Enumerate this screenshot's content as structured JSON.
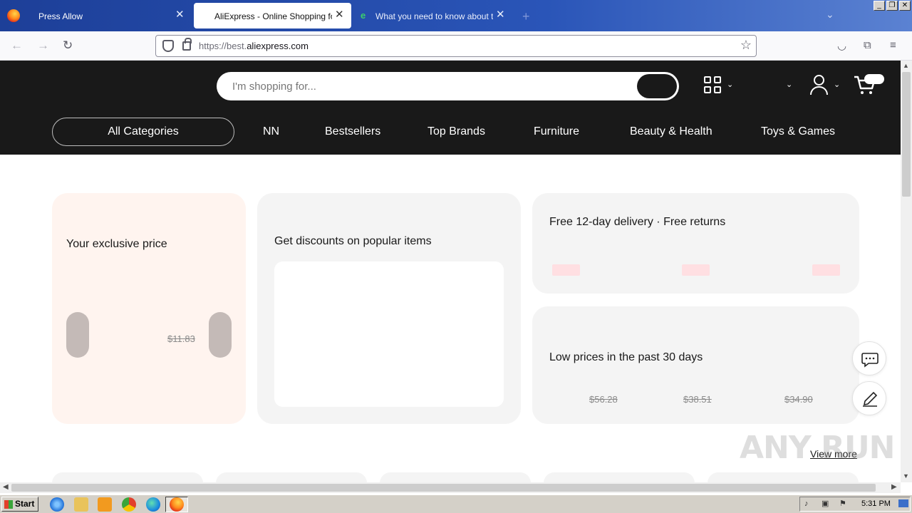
{
  "browser": {
    "tabs": [
      {
        "label": "Press Allow",
        "close": "✕"
      },
      {
        "label": "AliExpress - Online Shopping for Popular Electronics",
        "close": "✕"
      },
      {
        "label": "What you need to know about the",
        "close": "✕"
      }
    ],
    "new_tab": "+",
    "url_prefix": "https://best.",
    "url_domain": "aliexpress.com",
    "window_controls": [
      "_",
      "❐",
      "✕"
    ]
  },
  "site": {
    "search": {
      "placeholder": "I'm shopping for..."
    },
    "categories": {
      "all": "All Categories",
      "links": [
        "NN",
        "Bestsellers",
        "Top Brands",
        "Furniture",
        "Beauty & Health",
        "Toys & Games"
      ]
    }
  },
  "cards": {
    "exclusive": {
      "title": "Your exclusive price",
      "old_price": "$11.83"
    },
    "discounts": {
      "title": "Get discounts on popular items"
    },
    "delivery": {
      "title": "Free 12-day delivery · Free returns"
    },
    "low_prices": {
      "title": "Low prices in the past 30 days",
      "old_prices": [
        "$56.28",
        "$38.51",
        "$34.90"
      ]
    }
  },
  "view_more": "View more",
  "watermark": "ANY RUN",
  "taskbar": {
    "start": "Start",
    "clock": "5:31 PM"
  },
  "colors": {
    "header_bg": "#191919",
    "exclusive_card_bg": "#fff4ef",
    "card_bg": "#f4f4f4",
    "taskbar_bg": "#d4d0c8"
  }
}
